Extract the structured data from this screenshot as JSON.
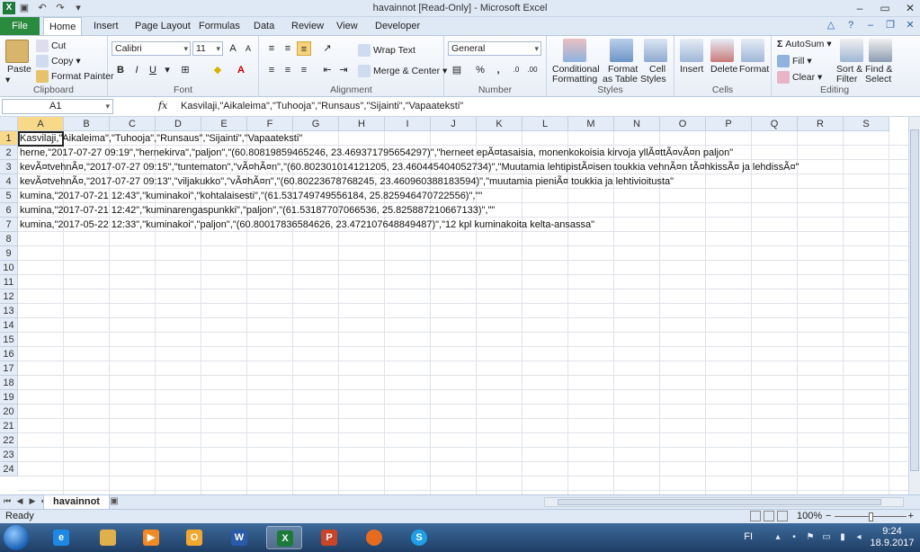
{
  "window": {
    "title": "havainnot  [Read-Only]  -  Microsoft Excel",
    "app_letter": "X"
  },
  "tabs": {
    "file": "File",
    "items": [
      "Home",
      "Insert",
      "Page Layout",
      "Formulas",
      "Data",
      "Review",
      "View",
      "Developer"
    ]
  },
  "ribbon": {
    "clipboard": {
      "label": "Clipboard",
      "paste": "Paste",
      "cut": "Cut",
      "copy": "Copy",
      "format_painter": "Format Painter"
    },
    "font": {
      "label": "Font",
      "font_name": "Calibri",
      "font_size": "11",
      "bold": "B",
      "italic": "I",
      "underline": "U"
    },
    "alignment": {
      "label": "Alignment",
      "wrap_text": "Wrap Text",
      "merge_center": "Merge & Center"
    },
    "number": {
      "label": "Number",
      "format": "General",
      "percent": "%",
      "comma": ","
    },
    "styles": {
      "label": "Styles",
      "conditional": "Conditional",
      "conditional2": "Formatting",
      "format_table": "Format",
      "format_table2": "as Table",
      "cell_styles": "Cell",
      "cell_styles2": "Styles"
    },
    "cells": {
      "label": "Cells",
      "insert": "Insert",
      "delete": "Delete",
      "format": "Format"
    },
    "editing": {
      "label": "Editing",
      "autosum": "AutoSum",
      "fill": "Fill",
      "clear": "Clear",
      "sort": "Sort &",
      "sort2": "Filter",
      "find": "Find &",
      "find2": "Select"
    }
  },
  "formula_bar": {
    "name_box": "A1",
    "fx": "fx",
    "content": "Kasvilaji,\"Aikaleima\",\"Tuhooja\",\"Runsaus\",\"Sijainti\",\"Vapaateksti\""
  },
  "columns": [
    "A",
    "B",
    "C",
    "D",
    "E",
    "F",
    "G",
    "H",
    "I",
    "J",
    "K",
    "L",
    "M",
    "N",
    "O",
    "P",
    "Q",
    "R",
    "S"
  ],
  "rows": [
    "1",
    "2",
    "3",
    "4",
    "5",
    "6",
    "7",
    "8",
    "9",
    "10",
    "11",
    "12",
    "13",
    "14",
    "15",
    "16",
    "17",
    "18",
    "19",
    "20",
    "21",
    "22",
    "23",
    "24"
  ],
  "cells": [
    "Kasvilaji,\"Aikaleima\",\"Tuhooja\",\"Runsaus\",\"Sijainti\",\"Vapaateksti\"",
    "herne,\"2017-07-27 09:19\",\"hernekirva\",\"paljon\",\"(60.80819859465246, 23.469371795654297)\",\"herneet epÃ¤tasaisia, monenkokoisia kirvoja yllÃ¤ttÃ¤vÃ¤n paljon\"",
    "kevÃ¤tvehnÃ¤,\"2017-07-27 09:15\",\"tuntematon\",\"vÃ¤hÃ¤n\",\"(60.802301014121205, 23.460445404052734)\",\"Muutamia lehtipistÃ¤isen toukkia vehnÃ¤n tÃ¤hkissÃ¤ ja lehdissÃ¤\"",
    "kevÃ¤tvehnÃ¤,\"2017-07-27 09:13\",\"viljakukko\",\"vÃ¤hÃ¤n\",\"(60.80223678768245, 23.460960388183594)\",\"muutamia pieniÃ¤ toukkia ja lehtivioitusta\"",
    "kumina,\"2017-07-21 12:43\",\"kuminakoi\",\"kohtalaisesti\",\"(61.531749749556184, 25.825946470722556)\",\"\"",
    "kumina,\"2017-07-21 12:42\",\"kuminarengaspunkki\",\"paljon\",\"(61.53187707066536, 25.825887210667133)\",\"\"",
    "kumina,\"2017-05-22 12:33\",\"kuminakoi\",\"paljon\",\"(60.80017836584626, 23.472107648849487)\",\"12 kpl kuminakoita kelta-ansassa\""
  ],
  "sheet": {
    "name": "havainnot"
  },
  "status": {
    "ready": "Ready",
    "zoom": "100%",
    "minus": "−",
    "plus": "+"
  },
  "taskbar": {
    "lang": "FI",
    "time": "9:24",
    "date": "18.9.2017"
  }
}
